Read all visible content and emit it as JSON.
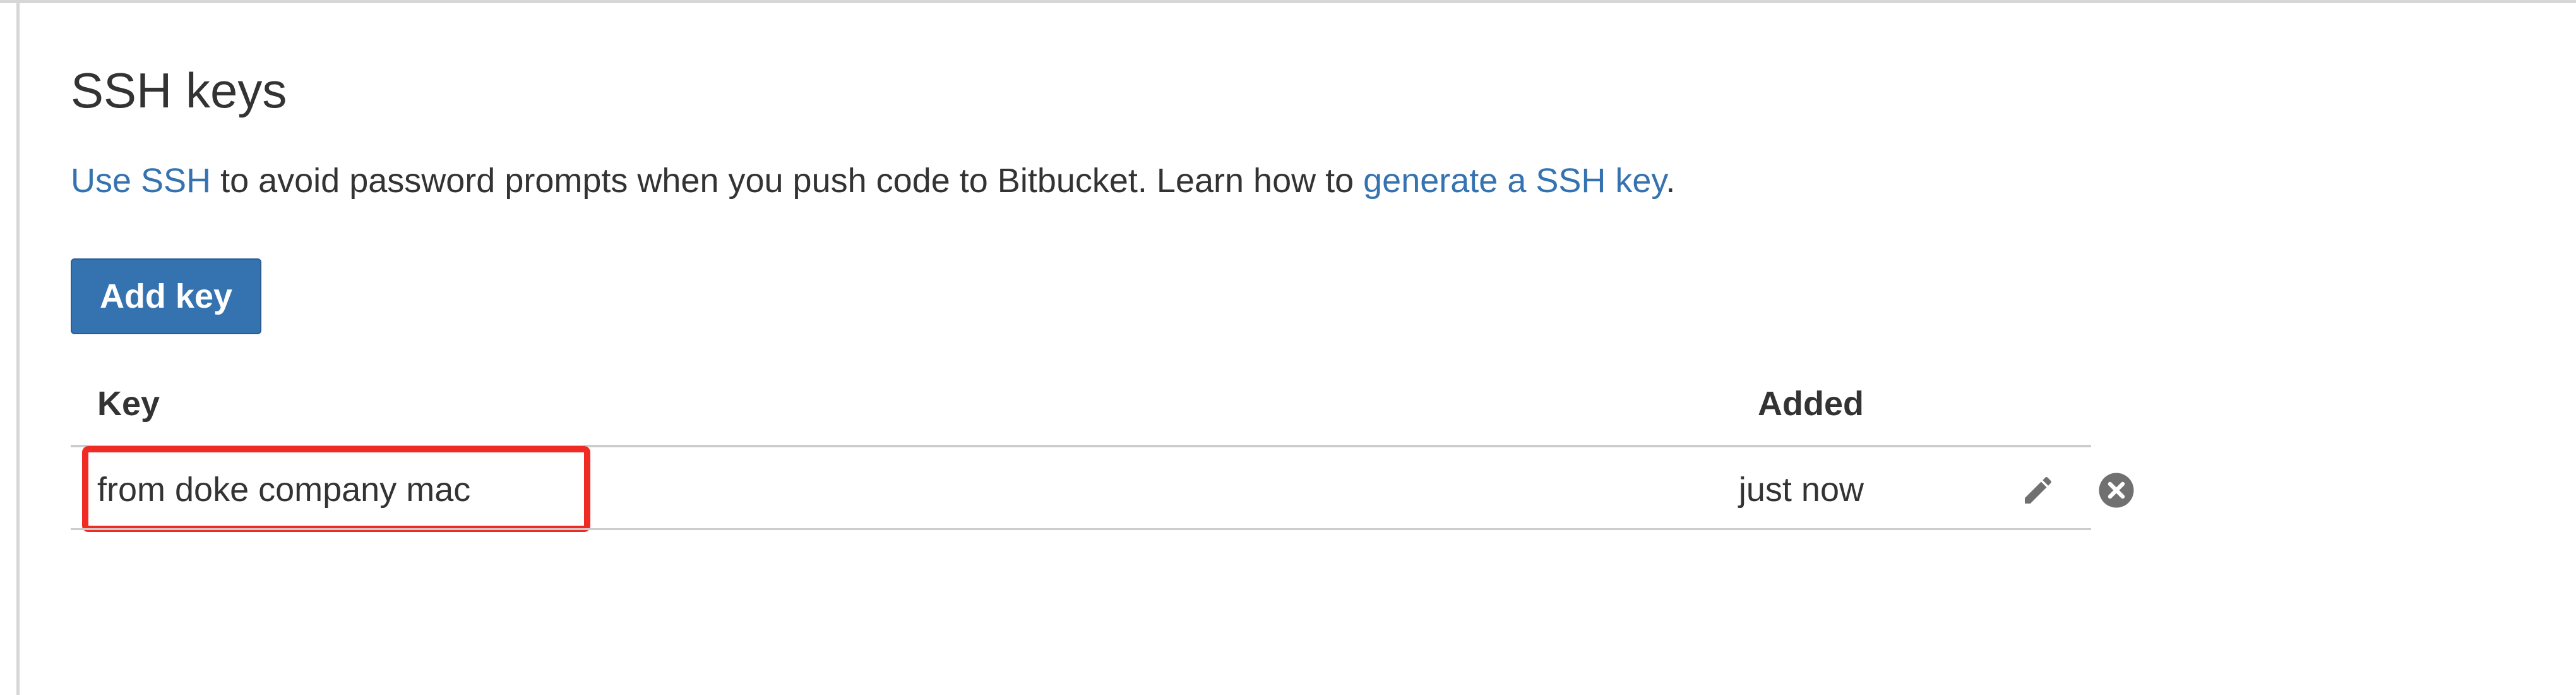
{
  "page": {
    "title": "SSH keys"
  },
  "intro": {
    "link_use_ssh": "Use SSH",
    "text_middle": " to avoid password prompts when you push code to Bitbucket. Learn how to ",
    "link_generate": "generate a SSH key",
    "text_end": "."
  },
  "actions": {
    "add_key_label": "Add key"
  },
  "table": {
    "headers": {
      "key": "Key",
      "added": "Added"
    },
    "rows": [
      {
        "key_label": "from doke company mac",
        "added": "just now",
        "actions": [
          "pencil-icon",
          "close-circle-icon"
        ]
      }
    ]
  },
  "colors": {
    "link": "#3572b0",
    "button": "#3572b0",
    "highlight": "#ef2b24",
    "icon": "#707070"
  }
}
